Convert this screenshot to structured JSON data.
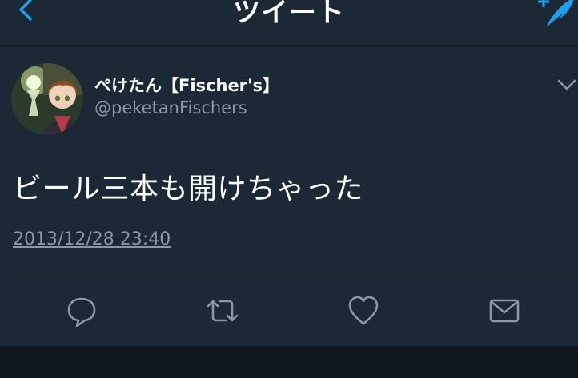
{
  "navbar": {
    "title": "ツイート",
    "back_icon": "chevron-left-icon",
    "compose_icon": "compose-feather-icon"
  },
  "tweet": {
    "display_name": "ぺけたん【Fischer's】",
    "handle": "@peketanFischers",
    "text": "ビール三本も開けちゃった",
    "timestamp": "2013/12/28 23:40"
  },
  "actions": [
    "reply-icon",
    "retweet-icon",
    "like-icon",
    "share-mail-icon"
  ],
  "colors": {
    "background": "#1b2836",
    "accent": "#1da1f2",
    "secondary_text": "#8899a6",
    "icon": "#8899a6",
    "divider": "#10171e"
  }
}
